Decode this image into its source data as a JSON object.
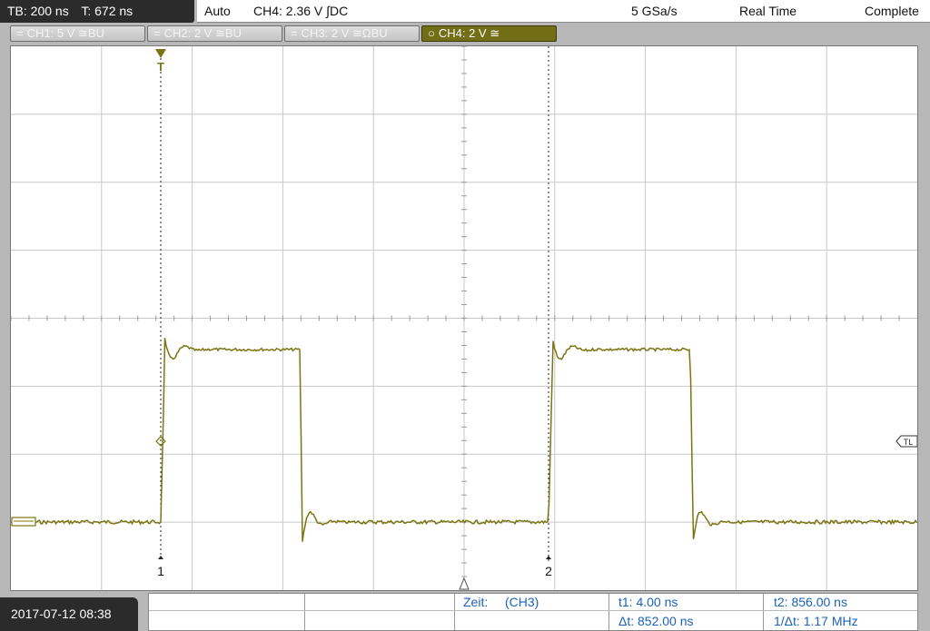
{
  "timebase": {
    "tb_label": "TB: 200 ns",
    "delay_label": "T: 672 ns"
  },
  "status": {
    "mode": "Auto",
    "trigger": "CH4: 2.36 V ∫DC",
    "sample_rate": "5 GSa/s",
    "acq_mode": "Real Time",
    "acq_state": "Complete"
  },
  "channels": [
    {
      "label": "CH1: 5 V",
      "coupling": "≅BU"
    },
    {
      "label": "CH2: 2 V",
      "coupling": "≅BU"
    },
    {
      "label": "CH3: 2 V",
      "coupling": "≅ΩBU"
    },
    {
      "label": "CH4: 2 V",
      "coupling": "≅"
    }
  ],
  "markers": {
    "trigger_t": "T",
    "cursor1": "1",
    "cursor2": "2",
    "trigger_level": "TL"
  },
  "footer": {
    "datetime": "2017-07-12 08:38",
    "meas_label": "Zeit:",
    "meas_source": "(CH3)",
    "t1": "t1: 4.00 ns",
    "t2": "t2: 856.00 ns",
    "dt": "Δt: 852.00 ns",
    "inv_dt": "1/Δt: 1.17 MHz"
  },
  "trace_color": "#7a7512",
  "grid_color": "#c8c8c8"
}
